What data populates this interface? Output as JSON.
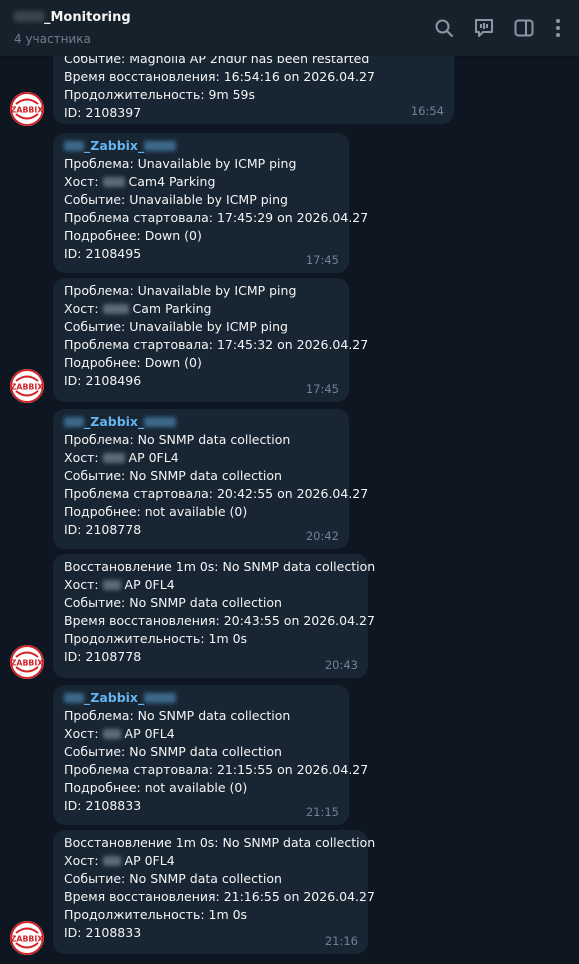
{
  "header": {
    "title_suffix": "_Monitoring",
    "subtitle": "4 участника"
  },
  "avatar_label": "ZABBIX",
  "messages": [
    {
      "lines": [
        "Событие: Magnolia AP 2nd0r has been restarted",
        "Время восстановления: 16:54:16 on 2026.04.27",
        "Продолжительность: 9m 59s",
        "ID: 2108397"
      ],
      "time": "16:54"
    },
    {
      "sender": "_Zabbix_",
      "problem": "Проблема: Unavailable by ICMP ping",
      "host_prefix": "Хост: ",
      "host_suffix": "Cam4 Parking",
      "event": "Событие: Unavailable by ICMP ping",
      "started": "Проблема стартовала: 17:45:29 on 2026.04.27",
      "details": "Подробнее: Down (0)",
      "id": "ID: 2108495",
      "time": "17:45"
    },
    {
      "problem": "Проблема: Unavailable by ICMP ping",
      "host_prefix": "Хост: ",
      "host_suffix": "Cam Parking",
      "event": "Событие: Unavailable by ICMP ping",
      "started": "Проблема стартовала: 17:45:32 on 2026.04.27",
      "details": "Подробнее: Down (0)",
      "id": "ID: 2108496",
      "time": "17:45"
    },
    {
      "sender": "_Zabbix_",
      "problem": "Проблема: No SNMP data collection",
      "host_prefix": "Хост: ",
      "host_suffix": "AP 0FL4",
      "event": "Событие: No SNMP data collection",
      "started": "Проблема стартовала: 20:42:55 on 2026.04.27",
      "details": "Подробнее: not available (0)",
      "id": "ID: 2108778",
      "time": "20:42"
    },
    {
      "recovery": "Восстановление 1m 0s: No SNMP data collection",
      "host_prefix": "Хост: ",
      "host_suffix": "AP 0FL4",
      "event": "Событие: No SNMP data collection",
      "restored": "Время восстановления: 20:43:55 on 2026.04.27",
      "duration": "Продолжительность: 1m 0s",
      "id": "ID: 2108778",
      "time": "20:43"
    },
    {
      "sender": "_Zabbix_",
      "problem": "Проблема: No SNMP data collection",
      "host_prefix": "Хост: ",
      "host_suffix": "AP 0FL4",
      "event": "Событие: No SNMP data collection",
      "started": "Проблема стартовала: 21:15:55 on 2026.04.27",
      "details": "Подробнее: not available (0)",
      "id": "ID: 2108833",
      "time": "21:15"
    },
    {
      "recovery": "Восстановление 1m 0s: No SNMP data collection",
      "host_prefix": "Хост: ",
      "host_suffix": "AP 0FL4",
      "event": "Событие: No SNMP data collection",
      "restored": "Время восстановления: 21:16:55 on 2026.04.27",
      "duration": "Продолжительность: 1m 0s",
      "id": "ID: 2108833",
      "time": "21:16"
    }
  ]
}
